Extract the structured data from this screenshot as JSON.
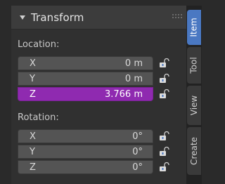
{
  "panel": {
    "title": "Transform"
  },
  "location": {
    "label": "Location:",
    "rows": [
      {
        "axis": "X",
        "value": "0 m"
      },
      {
        "axis": "Y",
        "value": "0 m"
      },
      {
        "axis": "Z",
        "value": "3.766 m"
      }
    ]
  },
  "rotation": {
    "label": "Rotation:",
    "rows": [
      {
        "axis": "X",
        "value": "0°"
      },
      {
        "axis": "Y",
        "value": "0°"
      },
      {
        "axis": "Z",
        "value": "0°"
      }
    ]
  },
  "tabs": [
    {
      "label": "Item",
      "active": true
    },
    {
      "label": "Tool",
      "active": false
    },
    {
      "label": "View",
      "active": false
    },
    {
      "label": "Create",
      "active": false
    }
  ],
  "colors": {
    "active_field": "#8f2ab0",
    "active_tab": "#4a78c2",
    "panel_bg": "#303030",
    "field_bg": "#545454"
  },
  "icons": {
    "header_caret": "caret-down-icon",
    "drag": "drag-handle-icon",
    "lock": "unlock-icon"
  }
}
